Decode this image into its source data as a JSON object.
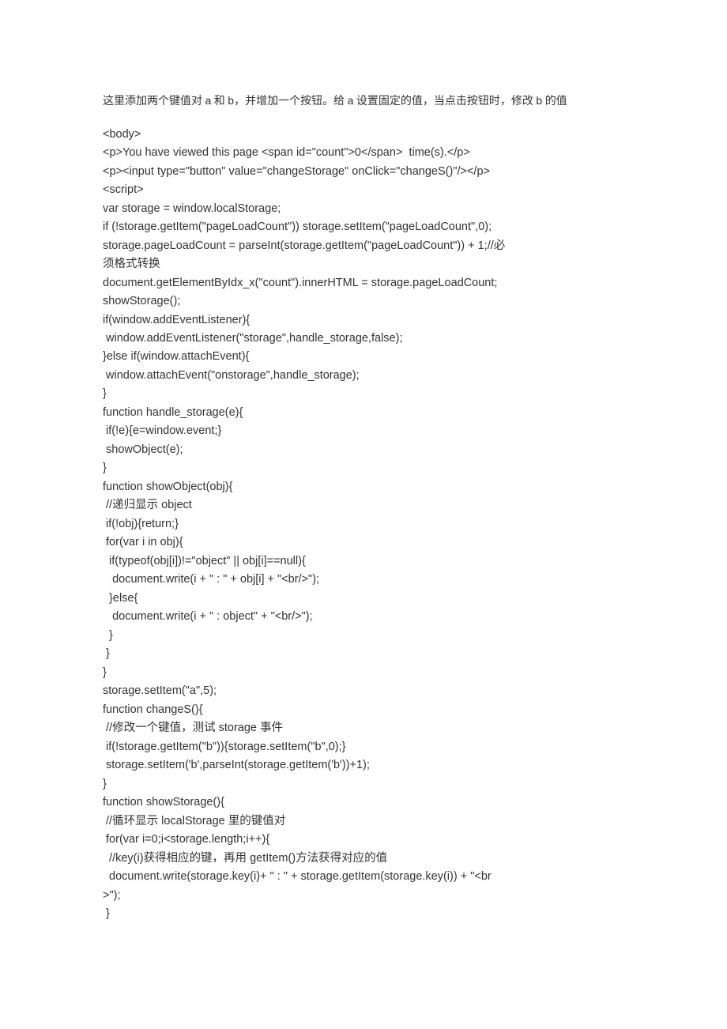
{
  "intro": {
    "seg1": "这里添加两个键值对 ",
    "a": "a",
    "seg2": " 和 ",
    "b": "b",
    "seg3": "，并增加一个按钮。给 ",
    "a2": "a",
    "seg4": " 设置固定的值，当点击按钮时，修改 ",
    "b2": "b",
    "seg5": " 的值"
  },
  "code": {
    "l1": "<body>",
    "l2": "<p>You have viewed this page <span id=\"count\">0</span>  time(s).</p>",
    "l3": "<p><input type=\"button\" value=\"changeStorage\" onClick=\"changeS()\"/></p>",
    "l4": "<script>",
    "l5": "var storage = window.localStorage;",
    "l6": "if (!storage.getItem(\"pageLoadCount\")) storage.setItem(\"pageLoadCount\",0);",
    "l7a": "storage.pageLoadCount = parseInt(storage.getItem(\"pageLoadCount\")) + 1;//",
    "l7b": "必",
    "l8": "须格式转换",
    "l9": "document.getElementByIdx_x(\"count\").innerHTML = storage.pageLoadCount;",
    "l10": "showStorage();",
    "l11": "if(window.addEventListener){",
    "l12": " window.addEventListener(\"storage\",handle_storage,false);",
    "l13": "}else if(window.attachEvent){",
    "l14": " window.attachEvent(\"onstorage\",handle_storage);",
    "l15": "}",
    "l16": "function handle_storage(e){",
    "l17": " if(!e){e=window.event;}",
    "l18": " showObject(e);",
    "l19": "}",
    "l20": "function showObject(obj){",
    "l21a": " //",
    "l21b": "递归显示",
    "l21c": " object",
    "l22": " if(!obj){return;}",
    "l23": " for(var i in obj){",
    "l24": "  if(typeof(obj[i])!=\"object\" || obj[i]==null){",
    "l25": "   document.write(i + \" : \" + obj[i] + \"<br/>\");",
    "l26": "  }else{",
    "l27": "   document.write(i + \" : object\" + \"<br/>\");",
    "l28": "  }",
    "l29": " }",
    "l30": "}",
    "l31": "storage.setItem(\"a\",5);",
    "l32": "function changeS(){",
    "l33a": " //",
    "l33b": "修改一个键值，测试",
    "l33c": " storage ",
    "l33d": "事件",
    "l34": " if(!storage.getItem(\"b\")){storage.setItem(\"b\",0);}",
    "l35": " storage.setItem('b',parseInt(storage.getItem('b'))+1);",
    "l36": "}",
    "l37": "function showStorage(){",
    "l38a": " //",
    "l38b": "循环显示",
    "l38c": " localStorage ",
    "l38d": "里的键值对",
    "l39": " for(var i=0;i<storage.length;i++){",
    "l40a": "  //key(i)",
    "l40b": "获得相应的键，再用",
    "l40c": " getItem()",
    "l40d": "方法获得对应的值",
    "l41": "  document.write(storage.key(i)+ \" : \" + storage.getItem(storage.key(i)) + \"<br",
    "l42": ">\");",
    "l43": " }"
  }
}
